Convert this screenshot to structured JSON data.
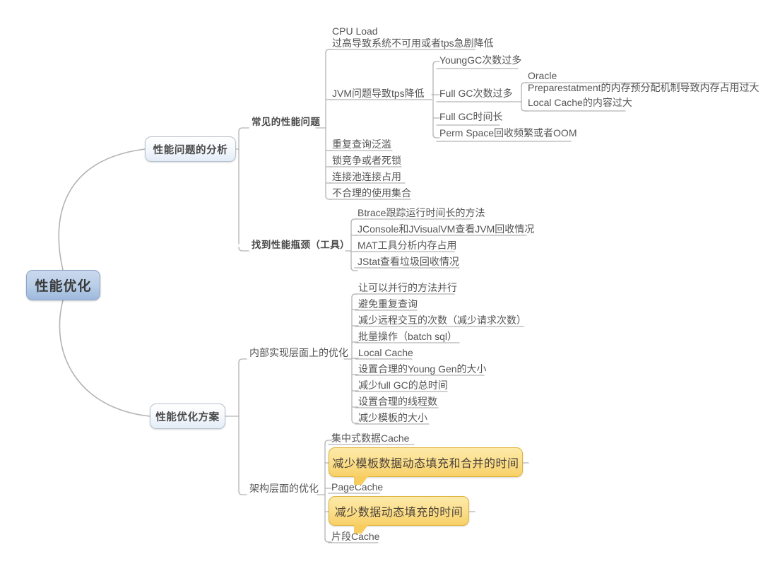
{
  "map": {
    "root": {
      "label": "性能优化"
    },
    "branches": [
      {
        "id": "analysis",
        "label": "性能问题的分析",
        "groups": [
          {
            "id": "common-problems",
            "label": "常见的性能问题",
            "items": [
              {
                "label": "CPU Load",
                "label2": "过高导致系统不可用或者tps急剧降低"
              },
              {
                "label": "JVM问题导致tps降低",
                "children": [
                  {
                    "label": "YoungGC次数过多"
                  },
                  {
                    "label": "Full GC次数过多",
                    "children": [
                      {
                        "label": "Oracle",
                        "label2": "Preparestatment的内存预分配机制导致内存占用过大"
                      },
                      {
                        "label": "Local Cache的内容过大"
                      }
                    ]
                  },
                  {
                    "label": "Full GC时间长"
                  },
                  {
                    "label": "Perm Space回收频繁或者OOM"
                  }
                ]
              },
              {
                "label": "重复查询泛滥"
              },
              {
                "label": "锁竞争或者死锁"
              },
              {
                "label": "连接池连接占用"
              },
              {
                "label": "不合理的使用集合"
              }
            ]
          },
          {
            "id": "bottleneck-tools",
            "label": "找到性能瓶颈（工具）",
            "items": [
              {
                "label": "Btrace跟踪运行时间长的方法"
              },
              {
                "label": "JConsole和JVisualVM查看JVM回收情况"
              },
              {
                "label": "MAT工具分析内存占用"
              },
              {
                "label": "JStat查看垃圾回收情况"
              }
            ]
          }
        ]
      },
      {
        "id": "solutions",
        "label": "性能优化方案",
        "groups": [
          {
            "id": "internal-impl",
            "label": "内部实现层面上的优化",
            "items": [
              {
                "label": "让可以并行的方法并行"
              },
              {
                "label": "避免重复查询"
              },
              {
                "label": "减少远程交互的次数（减少请求次数）"
              },
              {
                "label": "批量操作（batch sql）"
              },
              {
                "label": "Local Cache"
              },
              {
                "label": "设置合理的Young Gen的大小"
              },
              {
                "label": "减少full GC的总时间"
              },
              {
                "label": "设置合理的线程数"
              },
              {
                "label": "减少模板的大小"
              }
            ]
          },
          {
            "id": "architecture",
            "label": "架构层面的优化",
            "items": [
              {
                "label": "集中式数据Cache"
              },
              {
                "label": "减少模板数据动态填充和合并的时间",
                "style": "callout"
              },
              {
                "label": "PageCache"
              },
              {
                "label": "减少数据动态填充的时间",
                "style": "callout"
              },
              {
                "label": "片段Cache"
              }
            ]
          }
        ]
      }
    ]
  },
  "colors": {
    "root_fill_top": "#c9d8ee",
    "root_fill_bottom": "#9db9dd",
    "root_border": "#8fa7c6",
    "l2_border": "#b9c2cd",
    "callout_fill_top": "#fdeaa8",
    "callout_fill_bottom": "#f8d066",
    "callout_border": "#e2b33a",
    "connector": "#b3b3b3",
    "text": "#555555",
    "background": "#ffffff"
  }
}
